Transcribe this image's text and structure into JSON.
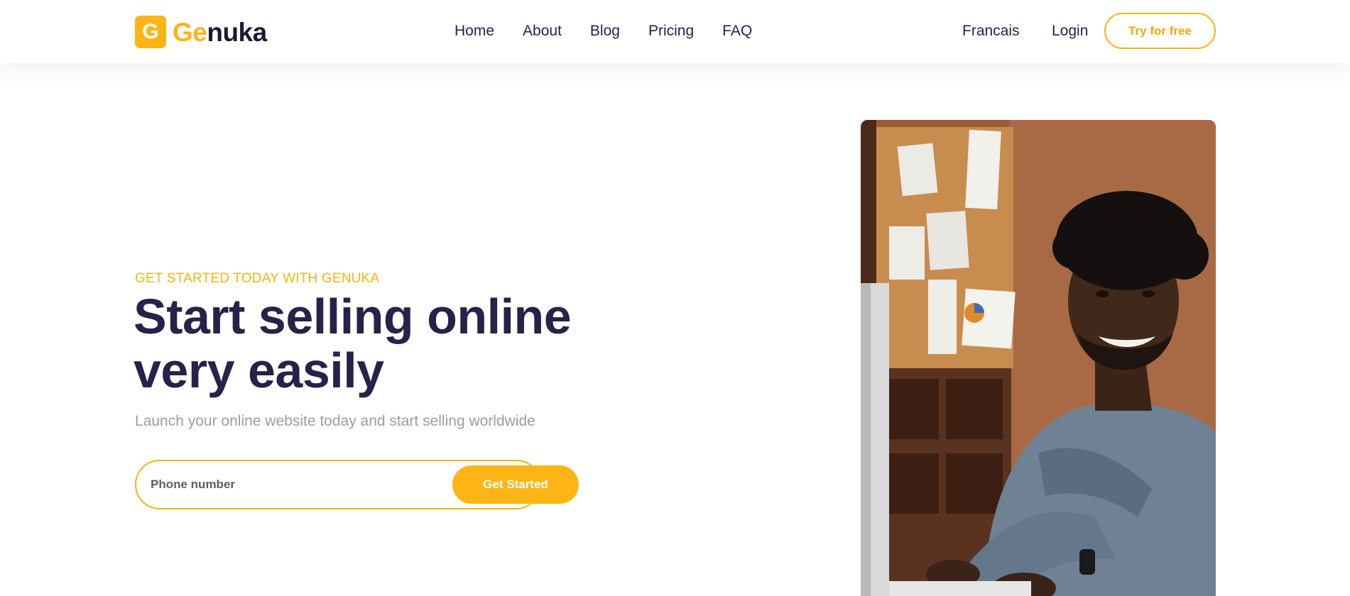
{
  "header": {
    "logo": {
      "letter": "G",
      "ge": "Ge",
      "rest": "nuka"
    },
    "nav": [
      "Home",
      "About",
      "Blog",
      "Pricing",
      "FAQ"
    ],
    "language": "Francais",
    "login": "Login",
    "cta": "Try for free"
  },
  "hero": {
    "eyebrow": "GET STARTED TODAY WITH GENUKA",
    "headline_line1": "Start selling online",
    "headline_line2": "very easily",
    "subline": "Launch your online website today and start selling worldwide",
    "phone_placeholder": "Phone number",
    "phone_value": "",
    "button": "Get Started"
  },
  "colors": {
    "accent": "#fdb515",
    "heading": "#26234a",
    "muted": "#9c9ca6"
  }
}
